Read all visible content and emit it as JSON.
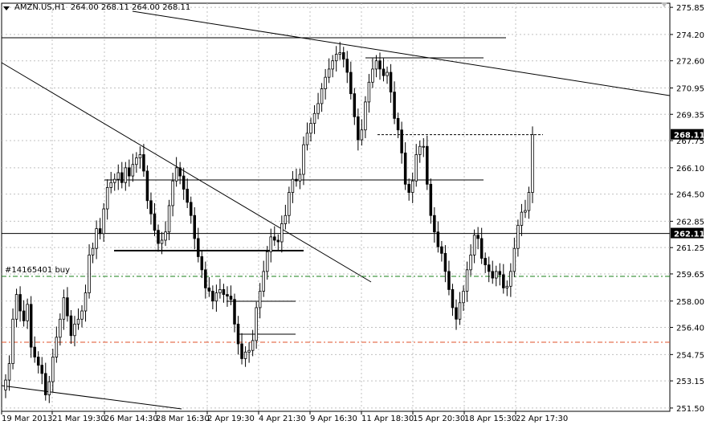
{
  "header": {
    "symbol": "AMZN.US,H1",
    "ohlc": "264.00 268.11 264.00 268.11"
  },
  "chart_data": {
    "type": "candlestick",
    "title": "AMZN.US,H1",
    "y_axis_ticks": [
      "275.85",
      "274.20",
      "272.60",
      "270.95",
      "269.35",
      "267.75",
      "266.10",
      "264.50",
      "262.85",
      "261.25",
      "259.65",
      "258.00",
      "256.40",
      "254.75",
      "253.15",
      "251.50"
    ],
    "x_axis_ticks": [
      "19 Mar 2013",
      "21 Mar 19:30",
      "26 Mar 14:30",
      "28 Mar 16:30",
      "2 Apr 19:30",
      "4 Apr 21:30",
      "9 Apr 16:30",
      "11 Apr 18:30",
      "15 Apr 20:30",
      "18 Apr 15:30",
      "22 Apr 17:30"
    ],
    "ylim": [
      251.3,
      276.1
    ],
    "price_labels": {
      "current": "268.11",
      "level": "262.11"
    },
    "order_label": "#14165401 buy",
    "levels": {
      "current": 268.11,
      "support": 262.11,
      "order_buy": 259.5,
      "stop": 255.5
    },
    "grid": true,
    "colors": {
      "background": "#ffffff",
      "grid": "#c0c0c0",
      "candle": "#000000",
      "order_line": "#1a7f1a",
      "stop_line": "#e0502a"
    },
    "close_series": [
      253.2,
      254.2,
      256.9,
      258.4,
      257.4,
      256.8,
      257.8,
      255.2,
      254.6,
      254.1,
      253.6,
      252.3,
      253.1,
      254.6,
      255.8,
      256.9,
      258.2,
      257.1,
      255.9,
      256.6,
      256.9,
      257.4,
      258.5,
      260.8,
      261.2,
      262.4,
      262.1,
      263.6,
      264.9,
      265.2,
      265.4,
      265.8,
      265.2,
      266.1,
      265.6,
      266.3,
      266.7,
      266.9,
      265.9,
      264.1,
      263.3,
      262.3,
      261.5,
      261.7,
      262.2,
      263.8,
      265.3,
      266.1,
      265.6,
      264.8,
      264.0,
      263.2,
      261.8,
      260.7,
      259.9,
      258.8,
      258.6,
      258.0,
      258.5,
      258.7,
      258.4,
      258.3,
      258.1,
      256.6,
      255.4,
      254.5,
      254.9,
      255.0,
      255.6,
      257.6,
      258.6,
      259.8,
      261.0,
      261.9,
      261.7,
      261.6,
      262.7,
      263.2,
      264.6,
      265.4,
      265.3,
      265.7,
      267.5,
      268.2,
      268.8,
      269.4,
      270.0,
      270.9,
      271.6,
      272.1,
      272.6,
      273.0,
      273.1,
      272.7,
      271.9,
      270.6,
      269.2,
      267.8,
      268.4,
      270.1,
      271.3,
      272.1,
      272.6,
      272.1,
      271.7,
      271.9,
      270.7,
      269.1,
      268.4,
      267.0,
      265.1,
      264.6,
      265.3,
      266.9,
      267.4,
      267.4,
      265.1,
      263.2,
      262.2,
      261.3,
      260.9,
      259.8,
      258.7,
      257.6,
      256.9,
      257.9,
      258.6,
      259.9,
      260.8,
      262.0,
      261.8,
      260.6,
      260.2,
      259.8,
      259.4,
      259.8,
      259.6,
      258.8,
      258.9,
      259.8,
      261.2,
      262.6,
      263.4,
      263.5,
      264.6,
      268.11
    ]
  }
}
